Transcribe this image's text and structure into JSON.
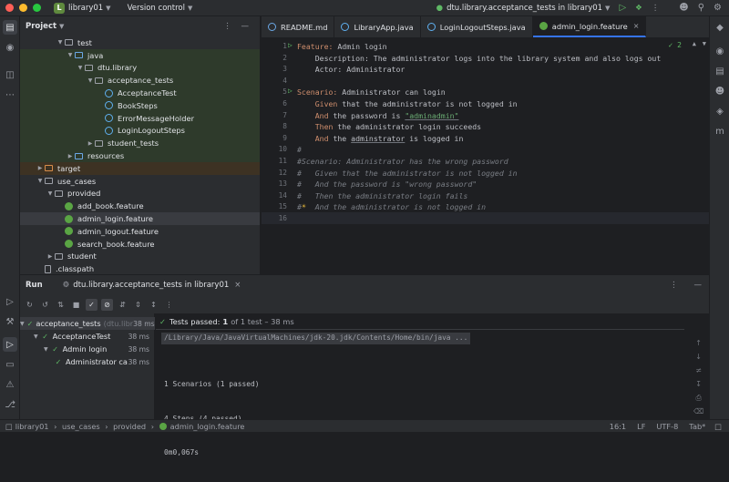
{
  "titlebar": {
    "project_badge": "L",
    "project_name": "library01",
    "version_control": "Version control",
    "run_config": "dtu.library.acceptance_tests in library01"
  },
  "project_panel": {
    "title": "Project",
    "tree": [
      {
        "label": "test",
        "depth": 3,
        "type": "folder",
        "arrow": "open"
      },
      {
        "label": "java",
        "depth": 4,
        "type": "folder-green",
        "arrow": "open",
        "hl": "green"
      },
      {
        "label": "dtu.library",
        "depth": 5,
        "type": "folder",
        "arrow": "open",
        "hl": "green"
      },
      {
        "label": "acceptance_tests",
        "depth": 6,
        "type": "folder",
        "arrow": "open",
        "hl": "green"
      },
      {
        "label": "AcceptanceTest",
        "depth": 7,
        "type": "class",
        "arrow": "",
        "hl": "green"
      },
      {
        "label": "BookSteps",
        "depth": 7,
        "type": "class",
        "arrow": "",
        "hl": "green"
      },
      {
        "label": "ErrorMessageHolder",
        "depth": 7,
        "type": "class",
        "arrow": "",
        "hl": "green"
      },
      {
        "label": "LoginLogoutSteps",
        "depth": 7,
        "type": "class",
        "arrow": "",
        "hl": "green"
      },
      {
        "label": "student_tests",
        "depth": 6,
        "type": "folder",
        "arrow": "closed",
        "hl": "green"
      },
      {
        "label": "resources",
        "depth": 4,
        "type": "folder-res",
        "arrow": "closed",
        "hl": "green"
      },
      {
        "label": "target",
        "depth": 1,
        "type": "folder-orange",
        "arrow": "closed",
        "hl": "orange"
      },
      {
        "label": "use_cases",
        "depth": 1,
        "type": "folder",
        "arrow": "open"
      },
      {
        "label": "provided",
        "depth": 2,
        "type": "folder",
        "arrow": "open"
      },
      {
        "label": "add_book.feature",
        "depth": 3,
        "type": "feature",
        "arrow": ""
      },
      {
        "label": "admin_login.feature",
        "depth": 3,
        "type": "feature",
        "arrow": "",
        "hl": "sel"
      },
      {
        "label": "admin_logout.feature",
        "depth": 3,
        "type": "feature",
        "arrow": ""
      },
      {
        "label": "search_book.feature",
        "depth": 3,
        "type": "feature",
        "arrow": ""
      },
      {
        "label": "student",
        "depth": 2,
        "type": "folder",
        "arrow": "closed"
      },
      {
        "label": ".classpath",
        "depth": 1,
        "type": "file",
        "arrow": ""
      }
    ]
  },
  "tabs": [
    {
      "label": "README.md",
      "color": "#6ba8e6",
      "active": false,
      "closable": false
    },
    {
      "label": "LibraryApp.java",
      "color": "#5fb0f0",
      "active": false,
      "closable": false
    },
    {
      "label": "LoginLogoutSteps.java",
      "color": "#5fb0f0",
      "active": false,
      "closable": false
    },
    {
      "label": "admin_login.feature",
      "color": "#5aa544",
      "active": true,
      "closable": true
    }
  ],
  "editor": {
    "inspection": "2",
    "lines": [
      [
        {
          "t": "Feature:",
          "c": "kw"
        },
        {
          "t": " Admin login"
        }
      ],
      [
        {
          "t": "    Description: The administrator logs into the library system and also logs out"
        }
      ],
      [
        {
          "t": "    Actor: Administrator"
        }
      ],
      [
        {
          "t": ""
        }
      ],
      [
        {
          "t": "Scenario:",
          "c": "kw"
        },
        {
          "t": " Administrator can login"
        }
      ],
      [
        {
          "t": "    "
        },
        {
          "t": "Given",
          "c": "kw"
        },
        {
          "t": " that the administrator is not logged in"
        }
      ],
      [
        {
          "t": "    "
        },
        {
          "t": "And",
          "c": "kw"
        },
        {
          "t": " the password is "
        },
        {
          "t": "\"adminadmin\"",
          "c": "str ul"
        }
      ],
      [
        {
          "t": "    "
        },
        {
          "t": "Then",
          "c": "kw"
        },
        {
          "t": " the administrator login succeeds"
        }
      ],
      [
        {
          "t": "    "
        },
        {
          "t": "And",
          "c": "kw"
        },
        {
          "t": " the "
        },
        {
          "t": "adminstrator",
          "c": "ul"
        },
        {
          "t": " is logged in"
        }
      ],
      [
        {
          "t": "#",
          "c": "cm"
        }
      ],
      [
        {
          "t": "#Scenario: Administrator has the wrong password",
          "c": "cm"
        }
      ],
      [
        {
          "t": "#   Given that the administrator is not logged in",
          "c": "cm"
        }
      ],
      [
        {
          "t": "#   And the password is \"wrong password\"",
          "c": "cm"
        }
      ],
      [
        {
          "t": "#   Then the administrator login fails",
          "c": "cm"
        }
      ],
      [
        {
          "t": "#   And the administrator is not logged in",
          "c": "cm"
        }
      ],
      [
        {
          "t": ""
        }
      ]
    ]
  },
  "run": {
    "title": "Run",
    "tab_label": "dtu.library.acceptance_tests in library01",
    "tests": [
      {
        "label": "acceptance_tests",
        "suffix": "(dtu.libr",
        "time": "38 ms",
        "depth": 0,
        "sel": true
      },
      {
        "label": "AcceptanceTest",
        "suffix": "",
        "time": "38 ms",
        "depth": 1,
        "sel": false
      },
      {
        "label": "Admin login",
        "suffix": "",
        "time": "38 ms",
        "depth": 2,
        "sel": false
      },
      {
        "label": "Administrator ca",
        "suffix": "",
        "time": "38 ms",
        "depth": 3,
        "sel": false
      }
    ],
    "summary_passed": "Tests passed:",
    "summary_count": "1",
    "summary_rest": "of 1 test – 38 ms",
    "command": "/Library/Java/JavaVirtualMachines/jdk-20.jdk/Contents/Home/bin/java ...",
    "output": [
      "1 Scenarios (1 passed)",
      "4 Steps (4 passed)",
      "0m0,067s"
    ]
  },
  "statusbar": {
    "crumbs": [
      "library01",
      "use_cases",
      "provided",
      "admin_login.feature"
    ],
    "position": "16:1",
    "line_sep": "LF",
    "encoding": "UTF-8",
    "indent": "Tab*"
  }
}
